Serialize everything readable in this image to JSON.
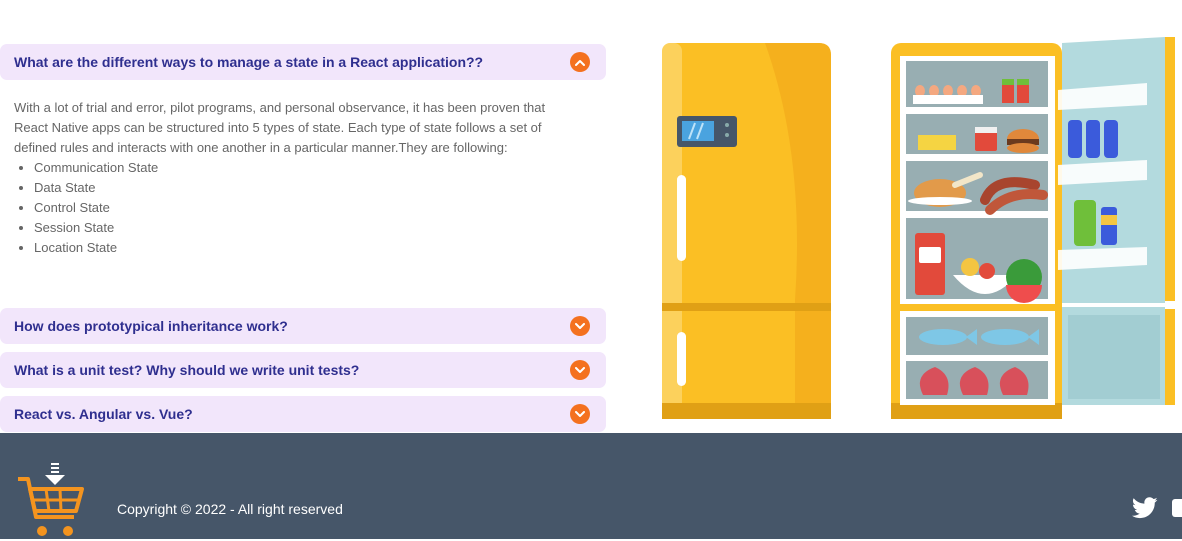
{
  "faq": {
    "items": [
      {
        "question": "What are the different ways to manage a state in a React application??",
        "expanded": true,
        "icon": "chevron-up-icon"
      },
      {
        "question": "How does prototypical inheritance work?",
        "expanded": false,
        "icon": "chevron-down-icon"
      },
      {
        "question": "What is a unit test? Why should we write unit tests?",
        "expanded": false,
        "icon": "chevron-down-icon"
      },
      {
        "question": "React vs. Angular vs. Vue?",
        "expanded": false,
        "icon": "chevron-down-icon"
      }
    ],
    "answer": {
      "paragraph": "With a lot of trial and error, pilot programs, and personal observance, it has been proven that React Native apps can be structured into 5 types of state. Each type of state follows a set of defined rules and interacts with one another in a particular manner.They are following:",
      "list": [
        "Communication State",
        "Data State",
        "Control State",
        "Session State",
        "Location State"
      ]
    }
  },
  "footer": {
    "copyright": "Copyright © 2022 - All right reserved",
    "social_icons": [
      "twitter-icon",
      "social-icon"
    ]
  },
  "colors": {
    "accent": "#f4711f",
    "faq_bg": "#f2e6fb",
    "faq_text": "#2f2f8f",
    "footer_bg": "#465669",
    "fridge_yellow": "#fbbf24"
  }
}
